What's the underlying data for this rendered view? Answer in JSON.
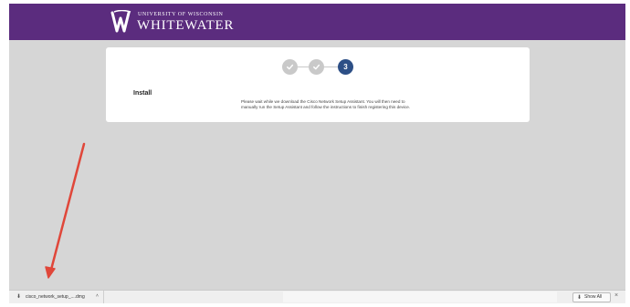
{
  "banner": {
    "university_line": "UNIVERSITY OF WISCONSIN",
    "campus_name": "WHITEWATER",
    "color": "#5b2c7e"
  },
  "installer": {
    "steps": [
      {
        "state": "complete",
        "icon": "check-icon"
      },
      {
        "state": "complete",
        "icon": "check-icon"
      },
      {
        "state": "current",
        "number": "3"
      }
    ],
    "title": "Install",
    "message": "Please wait while we download the Cisco Network Setup Assistant. You will then need to manually run the Setup Assistant and follow the instructions to finish registering this device.",
    "current_step_color": "#2d4f86"
  },
  "download_bar": {
    "file_name": "cisco_network_setup_....dmg",
    "caret": "˄",
    "show_all_label": "Show All",
    "close_glyph": "×"
  },
  "annotation": {
    "arrow_color": "#e0473a"
  }
}
